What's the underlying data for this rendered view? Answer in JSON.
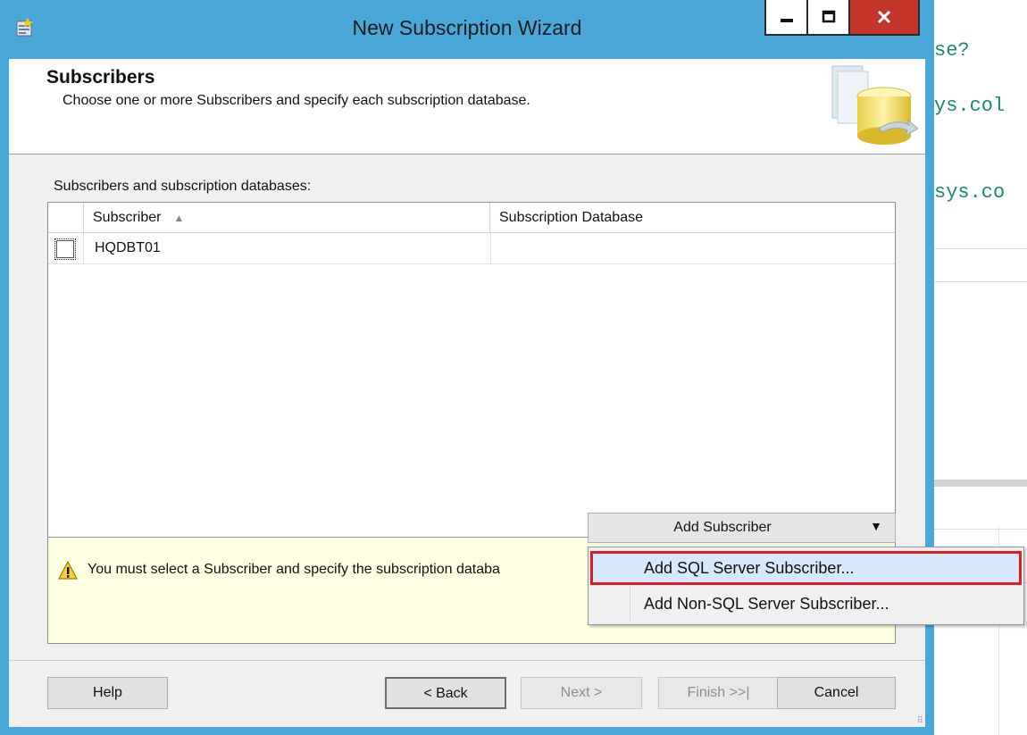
{
  "window": {
    "title": "New Subscription Wizard"
  },
  "header": {
    "title": "Subscribers",
    "subtitle": "Choose one or more Subscribers and specify each subscription database."
  },
  "grid": {
    "caption": "Subscribers and subscription databases:",
    "columns": [
      "Subscriber",
      "Subscription Database"
    ],
    "sort_column": "Subscriber",
    "rows": [
      {
        "checked": false,
        "subscriber": "HQDBT01",
        "database": ""
      }
    ]
  },
  "add_subscriber": {
    "label": "Add Subscriber",
    "menu": [
      "Add SQL Server Subscriber...",
      "Add Non-SQL Server Subscriber..."
    ],
    "highlighted_item": "Add SQL Server Subscriber..."
  },
  "message": {
    "text": "You must select a Subscriber and specify the subscription databa"
  },
  "footer": {
    "help": "Help",
    "back": "< Back",
    "next": "Next >",
    "finish": "Finish >>|",
    "cancel": "Cancel"
  },
  "background_code": {
    "lines": [
      "se?",
      "ys.col",
      "sys.co"
    ]
  },
  "colors": {
    "title_bar": "#4aa8d8",
    "close_button": "#c4352c",
    "highlight_border": "#e01b24",
    "code_text": "#1a8a6e",
    "message_bg": "#ffffe1"
  }
}
